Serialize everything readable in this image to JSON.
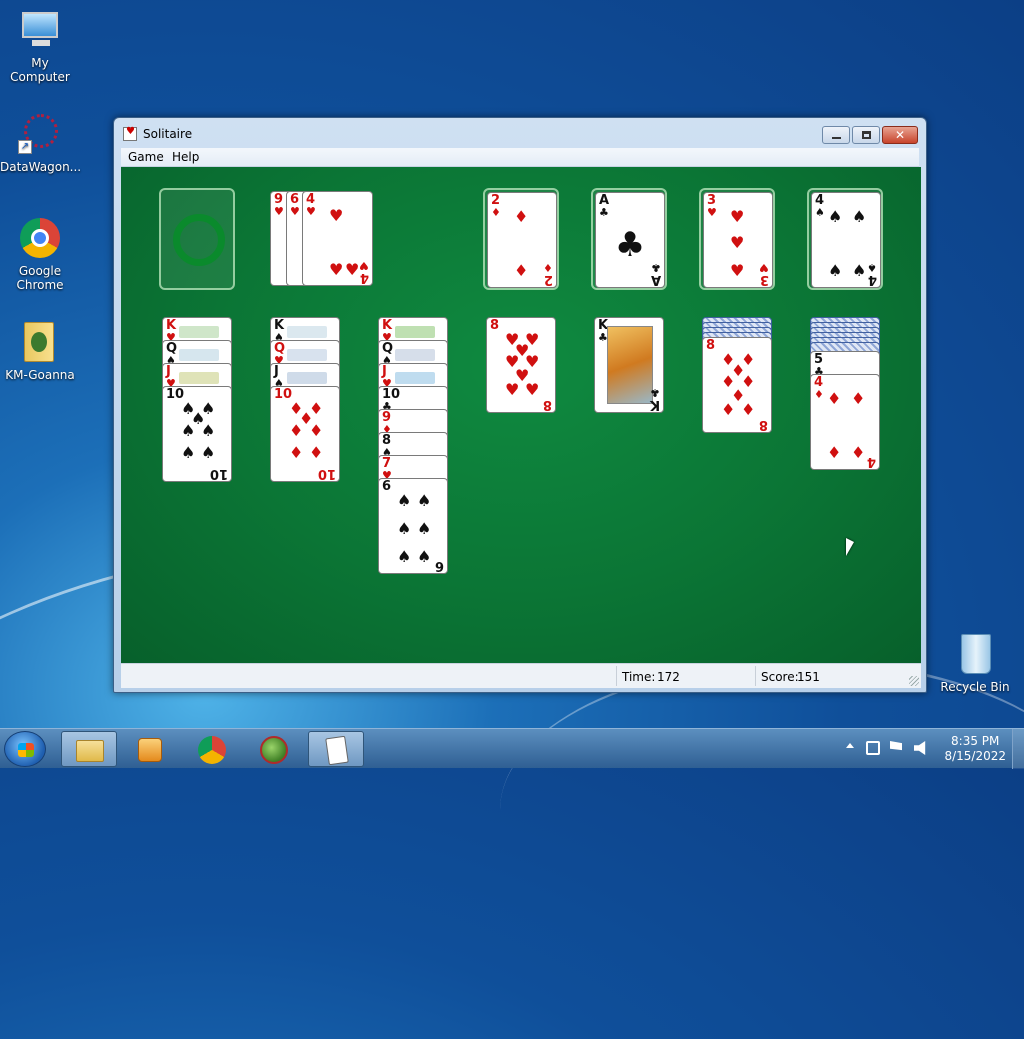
{
  "desktop": {
    "icons": [
      {
        "label": "My Computer",
        "icon": "computer-icon"
      },
      {
        "label": "DataWagon...",
        "icon": "datawagon-icon"
      },
      {
        "label": "Google Chrome",
        "icon": "chrome-icon"
      },
      {
        "label": "KM-Goanna",
        "icon": "folder-icon"
      },
      {
        "label": "Recycle Bin",
        "icon": "recycle-bin-icon"
      }
    ]
  },
  "window": {
    "title": "Solitaire",
    "menu": [
      "Game",
      "Help"
    ],
    "status": {
      "time_label": "Time:",
      "time_value": "172",
      "score_label": "Score:",
      "score_value": "151"
    }
  },
  "game": {
    "stock": "empty",
    "waste": [
      {
        "rank": "9",
        "suit": "♥"
      },
      {
        "rank": "6",
        "suit": "♥"
      },
      {
        "rank": "4",
        "suit": "♥"
      }
    ],
    "foundations": [
      {
        "rank": "2",
        "suit": "♦",
        "color": "red"
      },
      {
        "rank": "A",
        "suit": "♣",
        "color": "black"
      },
      {
        "rank": "3",
        "suit": "♥",
        "color": "red"
      },
      {
        "rank": "4",
        "suit": "♠",
        "color": "black"
      }
    ],
    "tableau": [
      [
        {
          "rank": "K",
          "suit": "♥"
        },
        {
          "rank": "Q",
          "suit": "♠"
        },
        {
          "rank": "J",
          "suit": "♥"
        },
        {
          "rank": "10",
          "suit": "♠"
        }
      ],
      [
        {
          "rank": "K",
          "suit": "♠"
        },
        {
          "rank": "Q",
          "suit": "♥"
        },
        {
          "rank": "J",
          "suit": "♠"
        },
        {
          "rank": "10",
          "suit": "♦"
        }
      ],
      [
        {
          "rank": "K",
          "suit": "♥"
        },
        {
          "rank": "Q",
          "suit": "♠"
        },
        {
          "rank": "J",
          "suit": "♥"
        },
        {
          "rank": "10",
          "suit": "♣"
        },
        {
          "rank": "9",
          "suit": "♦"
        },
        {
          "rank": "8",
          "suit": "♠"
        },
        {
          "rank": "7",
          "suit": "♥"
        },
        {
          "rank": "6",
          "suit": "♠"
        }
      ],
      [
        {
          "rank": "8",
          "suit": "♥"
        }
      ],
      [
        {
          "rank": "K",
          "suit": "♣"
        }
      ],
      [
        {
          "rank": "8",
          "suit": "♦"
        }
      ],
      [
        {
          "rank": "5",
          "suit": "♣"
        },
        {
          "rank": "4",
          "suit": "♦"
        }
      ]
    ]
  },
  "taskbar": {
    "clock_time": "8:35 PM",
    "clock_date": "8/15/2022"
  }
}
